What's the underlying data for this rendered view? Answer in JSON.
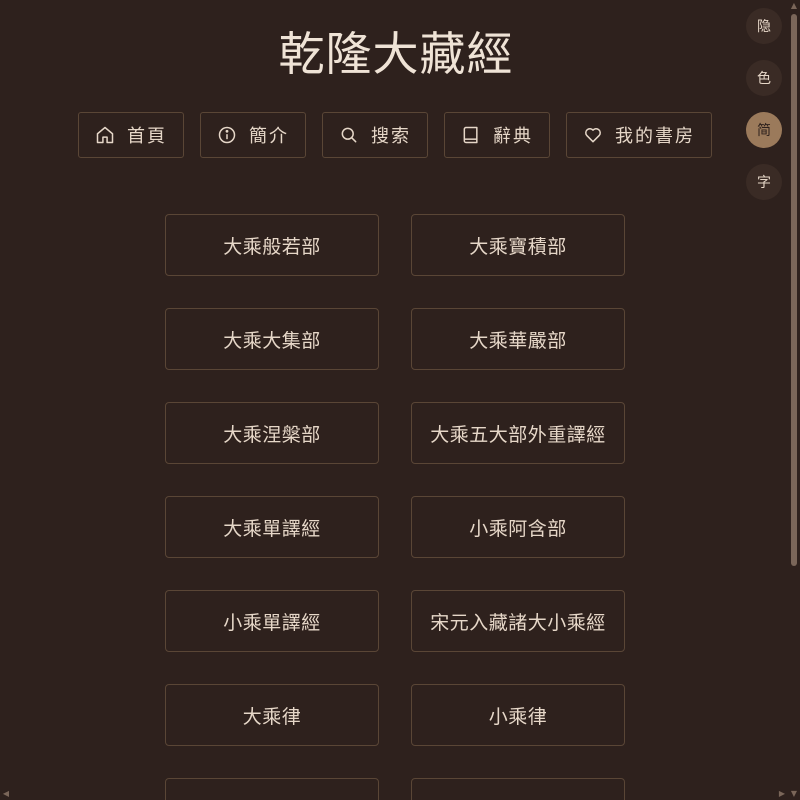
{
  "title": "乾隆大藏經",
  "nav": [
    {
      "icon": "home-icon",
      "label": "首頁"
    },
    {
      "icon": "info-icon",
      "label": "簡介"
    },
    {
      "icon": "search-icon",
      "label": "搜索"
    },
    {
      "icon": "book-icon",
      "label": "辭典"
    },
    {
      "icon": "heart-icon",
      "label": "我的書房"
    }
  ],
  "side": [
    "隐",
    "色",
    "简",
    "字"
  ],
  "sections": [
    "大乘般若部",
    "大乘寶積部",
    "大乘大集部",
    "大乘華嚴部",
    "大乘涅槃部",
    "大乘五大部外重譯經",
    "大乘單譯經",
    "小乘阿含部",
    "小乘單譯經",
    "宋元入藏諸大小乘經",
    "大乘律",
    "小乘律",
    "",
    ""
  ],
  "colors": {
    "background": "#2e211d",
    "text": "#e6d7c8",
    "border": "#5a4636",
    "active_side": "#9b7a5b"
  }
}
